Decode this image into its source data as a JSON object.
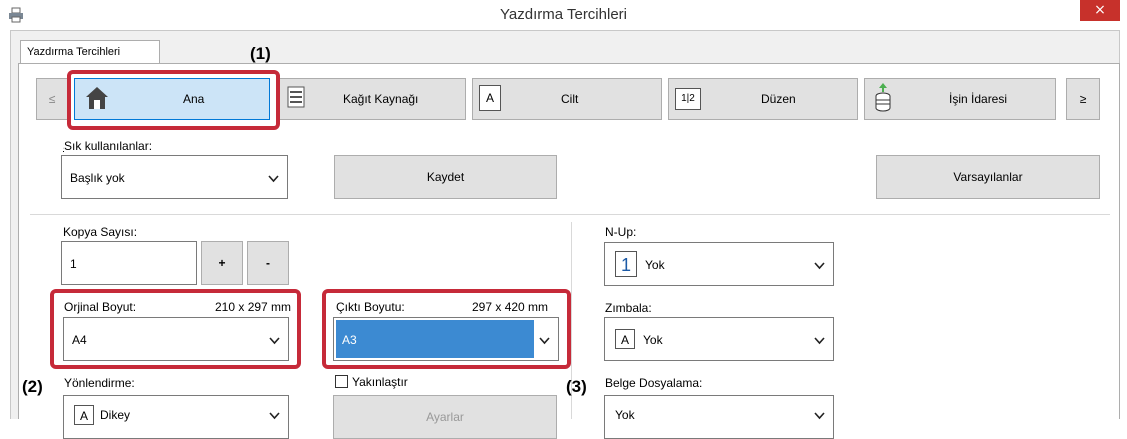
{
  "window": {
    "title": "Yazdırma Tercihleri",
    "close_glyph": "×",
    "icon": "printer-icon"
  },
  "tab": {
    "label": "Yazdırma Tercihleri"
  },
  "nav": {
    "prev_label": "≤",
    "next_label": "≥",
    "items": [
      {
        "label": "Ana",
        "icon": "home-icon"
      },
      {
        "label": "Kağıt Kaynağı",
        "icon": "paper-tray-icon"
      },
      {
        "label": "Cilt",
        "icon": "binding-icon"
      },
      {
        "label": "Düzen",
        "icon": "layout-icon"
      },
      {
        "label": "İşin İdaresi",
        "icon": "job-handling-icon"
      }
    ],
    "layout_icon_text": "1|2",
    "binding_icon_text": "A"
  },
  "favorites": {
    "label": "Sık kullanılanlar:",
    "value": "Başlık yok",
    "save_label": "Kaydet",
    "defaults_label": "Varsayılanlar"
  },
  "copies": {
    "label": "Kopya Sayısı:",
    "value": "1",
    "plus_label": "+",
    "minus_label": "-"
  },
  "original_size": {
    "label": "Orjinal Boyut:",
    "dims": "210 x 297 mm",
    "value": "A4"
  },
  "output_size": {
    "label": "Çıktı Boyutu:",
    "dims": "297 x 420 mm",
    "value": "A3"
  },
  "orientation": {
    "label": "Yönlendirme:",
    "value": "Dikey",
    "icon_text": "A"
  },
  "zoom": {
    "label": "Yakınlaştır",
    "checked": false,
    "settings_label": "Ayarlar"
  },
  "nup": {
    "label": "N-Up:",
    "value": "Yok",
    "icon_text": "1"
  },
  "staple": {
    "label": "Zımbala:",
    "value": "Yok",
    "icon_text": "A"
  },
  "filing": {
    "label": "Belge Dosyalama:",
    "value": "Yok"
  },
  "callouts": {
    "one": "(1)",
    "two": "(2)",
    "three": "(3)"
  },
  "colors": {
    "callout": "#c62a39",
    "selected_combo": "#3c8ad2",
    "close": "#c7312b",
    "selected_tab": "#cce4f7"
  }
}
